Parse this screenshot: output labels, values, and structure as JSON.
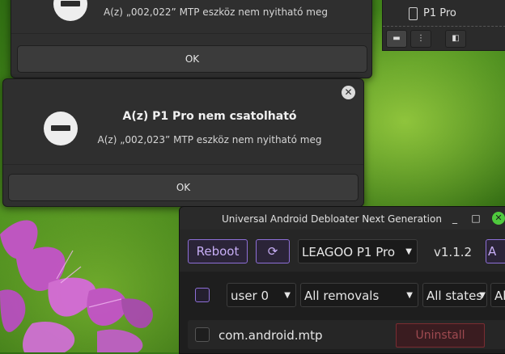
{
  "dialog_top": {
    "message": "A(z) „002,022” MTP eszköz nem nyitható meg",
    "ok_label": "OK"
  },
  "dialog_main": {
    "title": "A(z) P1 Pro nem csatolható",
    "message": "A(z) „002,023” MTP eszköz nem nyitható meg",
    "ok_label": "OK",
    "close_icon": "close-icon"
  },
  "file_manager": {
    "device_label": "P1 Pro",
    "toolbar_icons": [
      "folder-icon",
      "tree-icon",
      "sidebar-icon"
    ]
  },
  "uad": {
    "window_title": "Universal Android Debloater Next Generation",
    "window_controls": {
      "minimize": "_",
      "maximize": "□",
      "close": "✕"
    },
    "reboot_label": "Reboot",
    "refresh_icon": "refresh-icon",
    "device_select": "LEAGOO P1 Pro",
    "version": "v1.1.2",
    "cutoff_button_text": "A",
    "user_select": "user 0",
    "removal_select": "All removals",
    "state_select": "All states",
    "cutoff_select_text": "Al",
    "package_name": "com.android.mtp",
    "uninstall_label": "Uninstall"
  },
  "colors": {
    "accent_purple": "#8e6fd8",
    "danger_red": "#9e4a50",
    "close_green": "#4fc93d",
    "dialog_bg": "#2f2f2f"
  }
}
